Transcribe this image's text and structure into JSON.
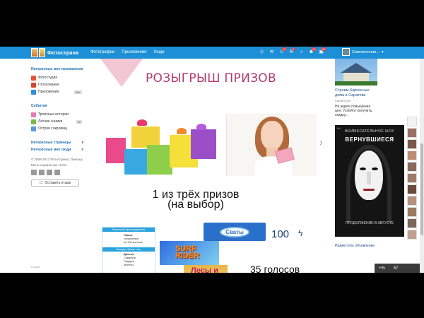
{
  "header": {
    "logo": "Фотострана",
    "nav": [
      "Фотографии",
      "Приложения",
      "Люди"
    ],
    "badges": [
      "42",
      "8",
      "10",
      "99"
    ],
    "user_name": "Симпатичная..."
  },
  "sidebar": {
    "section_apps": "Интересные мне приложения",
    "apps": [
      {
        "label": "Фотостудия",
        "color": "#e8503a"
      },
      {
        "label": "Голосование",
        "color": "#d3472f"
      },
      {
        "label": "Приложения",
        "color": "#2f8fd8",
        "count": "99+"
      }
    ],
    "section_events": "События",
    "events": [
      {
        "label": "Троичные истории",
        "color": "#e57cb0"
      },
      {
        "label": "Летние снимки",
        "color": "#7ab84a",
        "count": "12"
      },
      {
        "label": "Остров сокровищ",
        "color": "#5a9bd5"
      }
    ],
    "section_pages": "Интересные страницы",
    "section_people": "Интересные мне люди",
    "copyright": "© 2008-2017 Фотострана | Помощь",
    "social_label": "Мы в социальных сетях:",
    "feedback": "Оставить отзыв",
    "stream": "Стрим"
  },
  "promo": {
    "title": "РОЗЫГРЫШ ПРИЗОВ",
    "subtitle_line1": "1 из трёх призов",
    "subtitle_line2": "(на выбор)",
    "list_head": "Рамочный фотохудожник",
    "list_row1": "Новые",
    "list_row2": "Ускоренные",
    "list_row3": "на 100 монеток",
    "list_mid": "Конкурс Ярких лиц",
    "list_row4": "Дальше",
    "list_row5": "Сердечки",
    "list_row6": "Подарки",
    "list_row7": "Монеты",
    "svaty": "Сваты",
    "amount": "100",
    "surf": "SURF RIDER",
    "sweet": "Лесы и",
    "votes": "35 голосов"
  },
  "right": {
    "ad_title": "Строим Каркасные дома в Саратове",
    "ad_source": "rusdom.pro",
    "ad_text": "Не ждите повышения цен. Успейте получить скидку...",
    "poster_tag": "18+",
    "poster_top": "НЕИМЕСАТЕЛЬНОЕ ШОУ",
    "poster_title": "ВЕРНУВШИЕСЯ",
    "poster_bottom": "ПРОДОЛЖЕНИЕ В АВГУСТЕ",
    "place_ad": "Разместить объявление",
    "chat_plus": "+%",
    "chat_count": "57"
  }
}
